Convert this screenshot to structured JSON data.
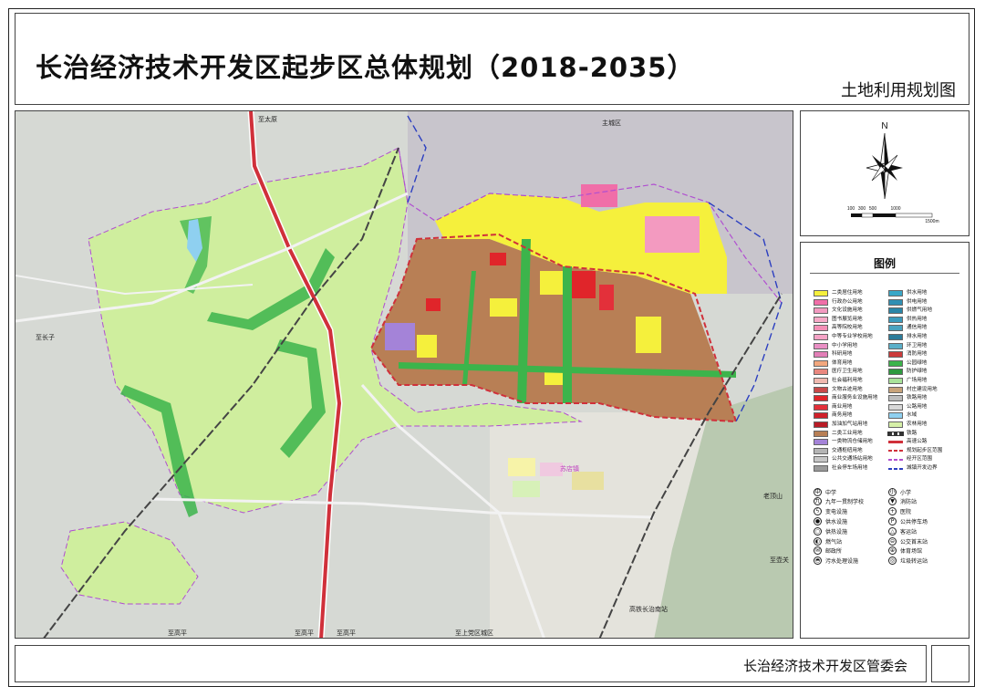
{
  "header": {
    "title": "长治经济技术开发区起步区总体规划（2018-2035）",
    "subtitle": "土地利用规划图"
  },
  "compass": {
    "north_label": "N",
    "scale_ticks": [
      "100",
      "300",
      "500",
      "1000",
      "1500m"
    ]
  },
  "map_labels": {
    "to_taiyuan": "至太原",
    "main_city": "主城区",
    "to_changzi": "至长子",
    "sudian": "苏店镇",
    "laoding_mountain": "老顶山",
    "to_huguan": "至壶关",
    "hsr_station": "高铁长治南站",
    "to_gaoping_1": "至高平",
    "to_gaoping_2": "至高平",
    "to_gaoping_3": "至高平",
    "to_shangdang": "至上党区城区"
  },
  "legend": {
    "title": "图例",
    "land_use_left": [
      {
        "label": "二类居住用地",
        "color": "#f5f03c"
      },
      {
        "label": "行政办公用地",
        "color": "#f06ea8"
      },
      {
        "label": "文化设施用地",
        "color": "#f39ac0"
      },
      {
        "label": "图书展览用地",
        "color": "#f7a9c7"
      },
      {
        "label": "高等院校用地",
        "color": "#f48fb6"
      },
      {
        "label": "中等专业学校用地",
        "color": "#f5a3c6"
      },
      {
        "label": "中小学用地",
        "color": "#e98fc4"
      },
      {
        "label": "科研用地",
        "color": "#e27fb7"
      },
      {
        "label": "体育用地",
        "color": "#f2a77e"
      },
      {
        "label": "医疗卫生用地",
        "color": "#e9877f"
      },
      {
        "label": "社会福利用地",
        "color": "#f0b9b0"
      },
      {
        "label": "文物古迹用地",
        "color": "#c84a4a"
      },
      {
        "label": "商业服务业设施用地",
        "color": "#e0252a"
      },
      {
        "label": "商业用地",
        "color": "#e3303a"
      },
      {
        "label": "商务用地",
        "color": "#d0202a"
      },
      {
        "label": "加油加气站用地",
        "color": "#b91c26"
      },
      {
        "label": "二类工业用地",
        "color": "#b87f55"
      },
      {
        "label": "一类物流仓储用地",
        "color": "#a483d8"
      },
      {
        "label": "交通枢纽用地",
        "color": "#b5b5b5"
      },
      {
        "label": "公共交通场站用地",
        "color": "#c7c7c7"
      },
      {
        "label": "社会停车场用地",
        "color": "#9a9a9a"
      }
    ],
    "land_use_right": [
      {
        "label": "供水用地",
        "color": "#3aa7c7",
        "kind": "fill"
      },
      {
        "label": "供电用地",
        "color": "#2f8fb3",
        "kind": "fill"
      },
      {
        "label": "供燃气用地",
        "color": "#2a86a8",
        "kind": "fill"
      },
      {
        "label": "供热用地",
        "color": "#3b9bbd",
        "kind": "fill"
      },
      {
        "label": "通信用地",
        "color": "#4aa3c0",
        "kind": "fill"
      },
      {
        "label": "排水用地",
        "color": "#2c7c9a",
        "kind": "fill"
      },
      {
        "label": "环卫用地",
        "color": "#5bb0c9",
        "kind": "fill"
      },
      {
        "label": "消防用地",
        "color": "#cc3b3b",
        "kind": "fill"
      },
      {
        "label": "公园绿地",
        "color": "#3cb44b",
        "kind": "fill"
      },
      {
        "label": "防护绿地",
        "color": "#2e9a3f",
        "kind": "fill"
      },
      {
        "label": "广场用地",
        "color": "#a9e39a",
        "kind": "fill"
      },
      {
        "label": "村庄建设用地",
        "color": "#c8a37a",
        "kind": "fill"
      },
      {
        "label": "铁路用地",
        "color": "#bcbcbc",
        "kind": "fill"
      },
      {
        "label": "公路用地",
        "color": "#d8d8d8",
        "kind": "fill"
      },
      {
        "label": "水域",
        "color": "#8fd0f0",
        "kind": "fill"
      },
      {
        "label": "农林用地",
        "color": "#d6f0a8",
        "kind": "fill"
      },
      {
        "label": "铁路",
        "color": "#333333",
        "kind": "rail"
      },
      {
        "label": "高速公路",
        "color": "#d0303a",
        "kind": "line"
      },
      {
        "label": "规划起步区范围",
        "color": "#d0303a",
        "kind": "dash"
      },
      {
        "label": "经开区范围",
        "color": "#b04fd0",
        "kind": "dash"
      },
      {
        "label": "城镇开发边界",
        "color": "#2c3fc0",
        "kind": "dash"
      }
    ],
    "symbols_left": [
      {
        "label": "中学",
        "glyph": "中"
      },
      {
        "label": "九年一贯制学校",
        "glyph": "九"
      },
      {
        "label": "变电设施",
        "glyph": "ϟ"
      },
      {
        "label": "供水设施",
        "glyph": "●"
      },
      {
        "label": "供热设施",
        "glyph": "○"
      },
      {
        "label": "燃气站",
        "glyph": "◐"
      },
      {
        "label": "邮政所",
        "glyph": "✉"
      },
      {
        "label": "污水处理设施",
        "glyph": "◓"
      }
    ],
    "symbols_right": [
      {
        "label": "小学",
        "glyph": "小"
      },
      {
        "label": "消防站",
        "glyph": "▼"
      },
      {
        "label": "医院",
        "glyph": "+"
      },
      {
        "label": "公共停车场",
        "glyph": "P"
      },
      {
        "label": "客运站",
        "glyph": "△"
      },
      {
        "label": "公交首末站",
        "glyph": "⊖"
      },
      {
        "label": "体育场馆",
        "glyph": "⊕"
      },
      {
        "label": "垃圾转运站",
        "glyph": "◎"
      }
    ]
  },
  "footer": {
    "organization": "长治经济技术开发区管委会"
  }
}
